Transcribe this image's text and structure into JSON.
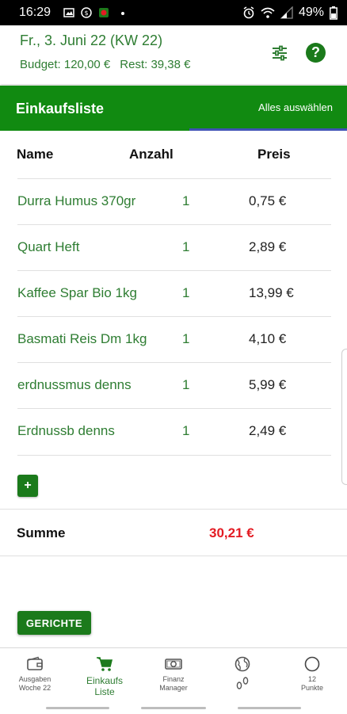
{
  "status_bar": {
    "time": "16:29",
    "battery": "49%"
  },
  "header": {
    "date": "Fr., 3. Juni 22 (KW 22)",
    "budget": "Budget: 120,00 €",
    "rest": "Rest: 39,38 €",
    "help_label": "?"
  },
  "list_bar": {
    "title": "Einkaufsliste",
    "select_all": "Alles auswählen"
  },
  "table": {
    "columns": [
      "Name",
      "Anzahl",
      "Preis"
    ],
    "rows": [
      {
        "name": "Durra Humus 370gr",
        "qty": "1",
        "price": "0,75 €"
      },
      {
        "name": "Quart Heft",
        "qty": "1",
        "price": "2,89 €"
      },
      {
        "name": "Kaffee Spar Bio 1kg",
        "qty": "1",
        "price": "13,99 €"
      },
      {
        "name": "Basmati Reis Dm 1kg",
        "qty": "1",
        "price": "4,10 €"
      },
      {
        "name": "erdnussmus denns",
        "qty": "1",
        "price": "5,99 €"
      },
      {
        "name": "Erdnussb denns",
        "qty": "1",
        "price": "2,49 €"
      }
    ],
    "add_label": "+"
  },
  "summary": {
    "label": "Summe",
    "value": "30,21 €"
  },
  "gerichte_label": "GERICHTE",
  "bottom_nav": [
    {
      "label_1": "Ausgaben",
      "label_2": "Woche 22",
      "icon": "wallet-icon"
    },
    {
      "label_1": "Einkaufs",
      "label_2": "Liste",
      "icon": "cart-icon"
    },
    {
      "label_1": "Finanz",
      "label_2": "Manager",
      "icon": "money-icon"
    },
    {
      "label_1": "",
      "label_2": "",
      "icon": "globe-footprints-icon"
    },
    {
      "label_1": "12",
      "label_2": "Punkte",
      "icon": "circle-icon"
    }
  ],
  "colors": {
    "primary_green": "#118a11",
    "text_green": "#2e7d32",
    "sum_red": "#e31b23",
    "tab_indicator": "#3f51b5"
  }
}
